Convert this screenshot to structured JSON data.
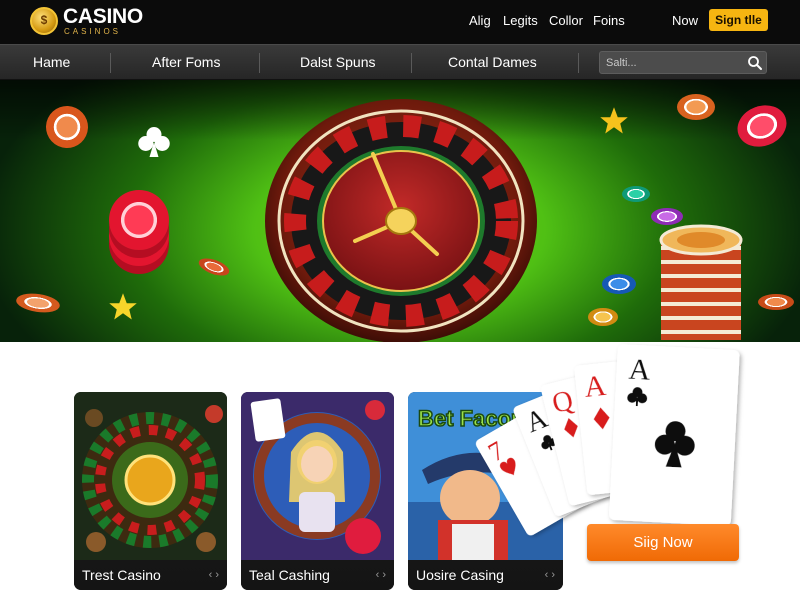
{
  "brand": {
    "name": "CASINO",
    "tagline": "CASINOS",
    "mark": "$"
  },
  "top_nav": {
    "links": [
      "Alig",
      "Legits",
      "Collor",
      "Foins",
      "Now"
    ],
    "signup_label": "Sig⁠n tlle"
  },
  "main_nav": {
    "items": [
      "Hame",
      "After Foms",
      "Dalst Spuns",
      "Contal Dames"
    ],
    "search_placeholder": "Salti..."
  },
  "cards": [
    {
      "title": "Trest Casino",
      "nav": "‹ ›"
    },
    {
      "title": "Teal Cashing",
      "nav": "‹ ›"
    },
    {
      "title": "Uosire Casing",
      "nav": "‹ ›",
      "art_text": "Bet Facom!"
    }
  ],
  "playing_cards": [
    "7",
    "A",
    "Q",
    "A",
    "A"
  ],
  "cta_label": "Siig Now",
  "colors": {
    "accent_orange": "#f06a05",
    "signup_yellow": "#f6b511",
    "felt_green": "#4fbf14",
    "chip_red": "#e8243b"
  },
  "icons": [
    "casino-logo-icon",
    "search-icon",
    "roulette-wheel",
    "chip",
    "star",
    "club-icon",
    "spade-icon",
    "heart-icon",
    "diamond-icon"
  ]
}
